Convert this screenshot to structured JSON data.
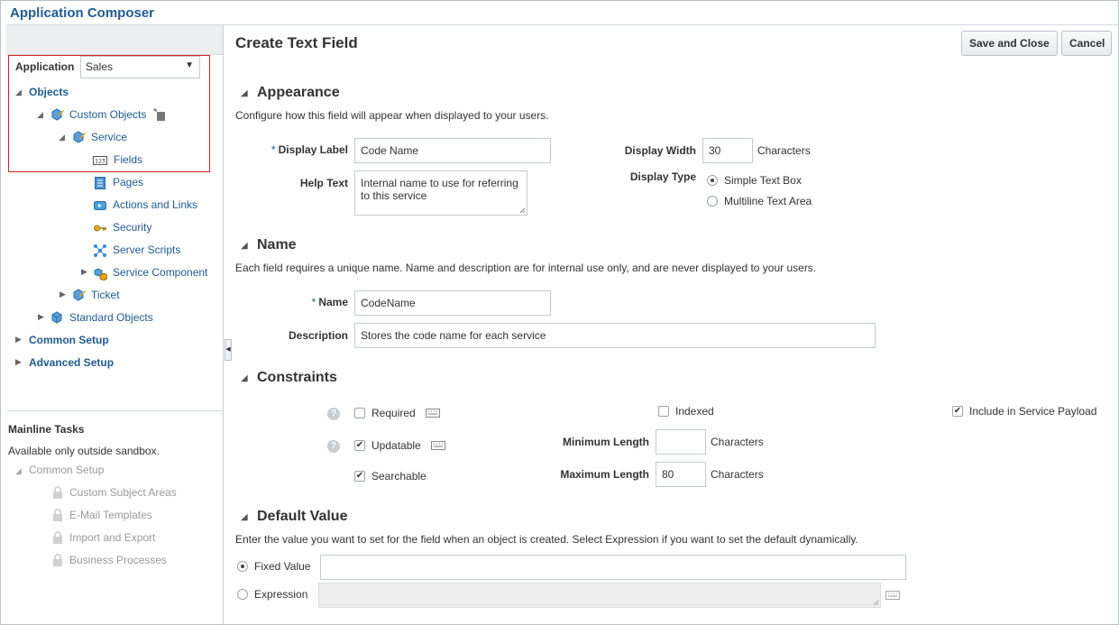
{
  "app": {
    "title": "Application Composer"
  },
  "nav": {
    "application_label": "Application",
    "application_value": "Sales",
    "objects": "Objects",
    "custom_objects": "Custom Objects",
    "service": "Service",
    "fields": "Fields",
    "pages": "Pages",
    "actions_links": "Actions and Links",
    "security": "Security",
    "server_scripts": "Server Scripts",
    "service_component": "Service Component",
    "ticket": "Ticket",
    "standard_objects": "Standard Objects",
    "common_setup": "Common Setup",
    "advanced_setup": "Advanced Setup"
  },
  "tasks": {
    "title": "Mainline Tasks",
    "note": "Available only outside sandbox.",
    "common_setup": "Common Setup",
    "items": [
      "Custom Subject Areas",
      "E-Mail Templates",
      "Import and Export",
      "Business Processes"
    ]
  },
  "page": {
    "title": "Create Text Field",
    "save_close": "Save and Close",
    "cancel": "Cancel"
  },
  "appearance": {
    "title": "Appearance",
    "desc": "Configure how this field will appear when displayed to your users.",
    "display_label": "Display Label",
    "display_label_value": "Code Name",
    "help_text": "Help Text",
    "help_text_value": "Internal name to use for referring to this service",
    "display_width": "Display Width",
    "display_width_value": "30",
    "characters": "Characters",
    "display_type": "Display Type",
    "simple_text_box": "Simple Text Box",
    "multiline_text_area": "Multiline Text Area"
  },
  "name_section": {
    "title": "Name",
    "desc": "Each field requires a unique name. Name and description are for internal use only, and are never displayed to your users.",
    "name_label": "Name",
    "name_value": "CodeName",
    "description_label": "Description",
    "description_value": "Stores the code name for each service"
  },
  "constraints": {
    "title": "Constraints",
    "required": "Required",
    "updatable": "Updatable",
    "searchable": "Searchable",
    "indexed": "Indexed",
    "include_payload": "Include in Service Payload",
    "min_length": "Minimum Length",
    "min_length_value": "",
    "max_length": "Maximum Length",
    "max_length_value": "80",
    "characters": "Characters"
  },
  "default_value": {
    "title": "Default Value",
    "desc": "Enter the value you want to set for the field when an object is created. Select Expression if you want to set the default dynamically.",
    "fixed_value": "Fixed Value",
    "expression": "Expression",
    "fixed_value_text": "",
    "expression_text": ""
  },
  "colors": {
    "link": "#1e5a96",
    "highlight": "#d42222",
    "disabled": "#9a9a9a"
  },
  "help_glyph": "?"
}
